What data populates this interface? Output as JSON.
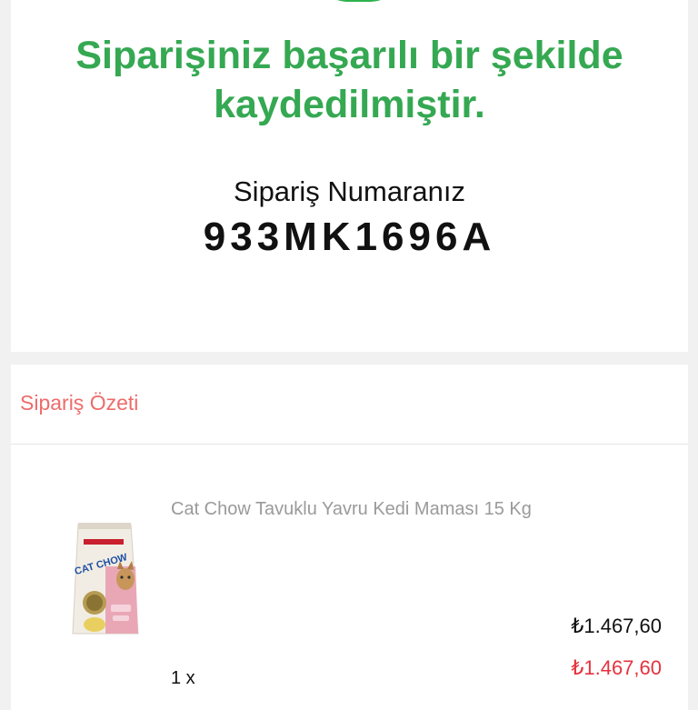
{
  "confirmation": {
    "title": "Siparişiniz başarılı bir şekilde kaydedilmiştir.",
    "order_label": "Sipariş Numaranız",
    "order_number": "933MK1696A",
    "accent_color": "#35a852",
    "icon": "check-circle-icon"
  },
  "summary": {
    "title": "Sipariş Özeti",
    "items": [
      {
        "name": "Cat Chow Tavuklu Yavru Kedi Maması 15 Kg",
        "image_icon": "cat-food-bag-image",
        "image_text": "CAT CHOW",
        "unit_price": "₺1.467,60",
        "quantity": "1 x",
        "total_price": "₺1.467,60"
      }
    ]
  }
}
